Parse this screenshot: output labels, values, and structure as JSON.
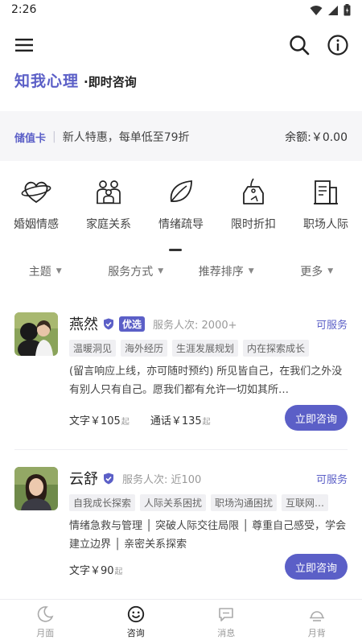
{
  "status": {
    "time": "2:26"
  },
  "brand": {
    "logo": "知我心理",
    "subtitle": "·即时咨询"
  },
  "card": {
    "tag": "储值卡",
    "separator": "|",
    "promo": "新人特惠，每单低至79折",
    "balance": "余额:￥0.00"
  },
  "categories": [
    {
      "label": "婚姻情感",
      "icon": "heart-ring-icon"
    },
    {
      "label": "家庭关系",
      "icon": "family-icon"
    },
    {
      "label": "情绪疏导",
      "icon": "leaf-icon"
    },
    {
      "label": "限时折扣",
      "icon": "price-tag-icon"
    },
    {
      "label": "职场人际",
      "icon": "office-building-icon"
    }
  ],
  "filters": [
    "主题",
    "服务方式",
    "推荐排序",
    "更多"
  ],
  "counselors": [
    {
      "name": "燕然",
      "badge": "优选",
      "served": "服务人次: 2000+",
      "status": "可服务",
      "tags": [
        "温暖洞见",
        "海外经历",
        "生涯发展规划",
        "内在探索成长"
      ],
      "desc": "(留言响应上线，亦可随时预约) 所见皆自己，在我们之外没有别人只有自己。愿我们都有允许一切如其所…",
      "price_text": "文字￥105",
      "price_text_unit": "起",
      "price_call": "通话￥135",
      "price_call_unit": "起",
      "button": "立即咨询"
    },
    {
      "name": "云舒",
      "served": "服务人次: 近100",
      "status": "可服务",
      "tags": [
        "自我成长探索",
        "人际关系困扰",
        "职场沟通困扰",
        "互联网…"
      ],
      "desc": "情绪急救与管理 │ 突破人际交往局限 │ 尊重自己感受，学会建立边界 │ 亲密关系探索",
      "price_text": "文字￥90",
      "price_text_unit": "起",
      "button": "立即咨询"
    }
  ],
  "tabs": [
    {
      "label": "月面",
      "icon": "moon-icon"
    },
    {
      "label": "咨询",
      "icon": "smile-icon",
      "active": true
    },
    {
      "label": "消息",
      "icon": "chat-icon"
    },
    {
      "label": "月背",
      "icon": "moon-back-icon"
    }
  ],
  "colors": {
    "accent": "#5b5fc7",
    "text": "#222222",
    "muted": "#999999"
  }
}
